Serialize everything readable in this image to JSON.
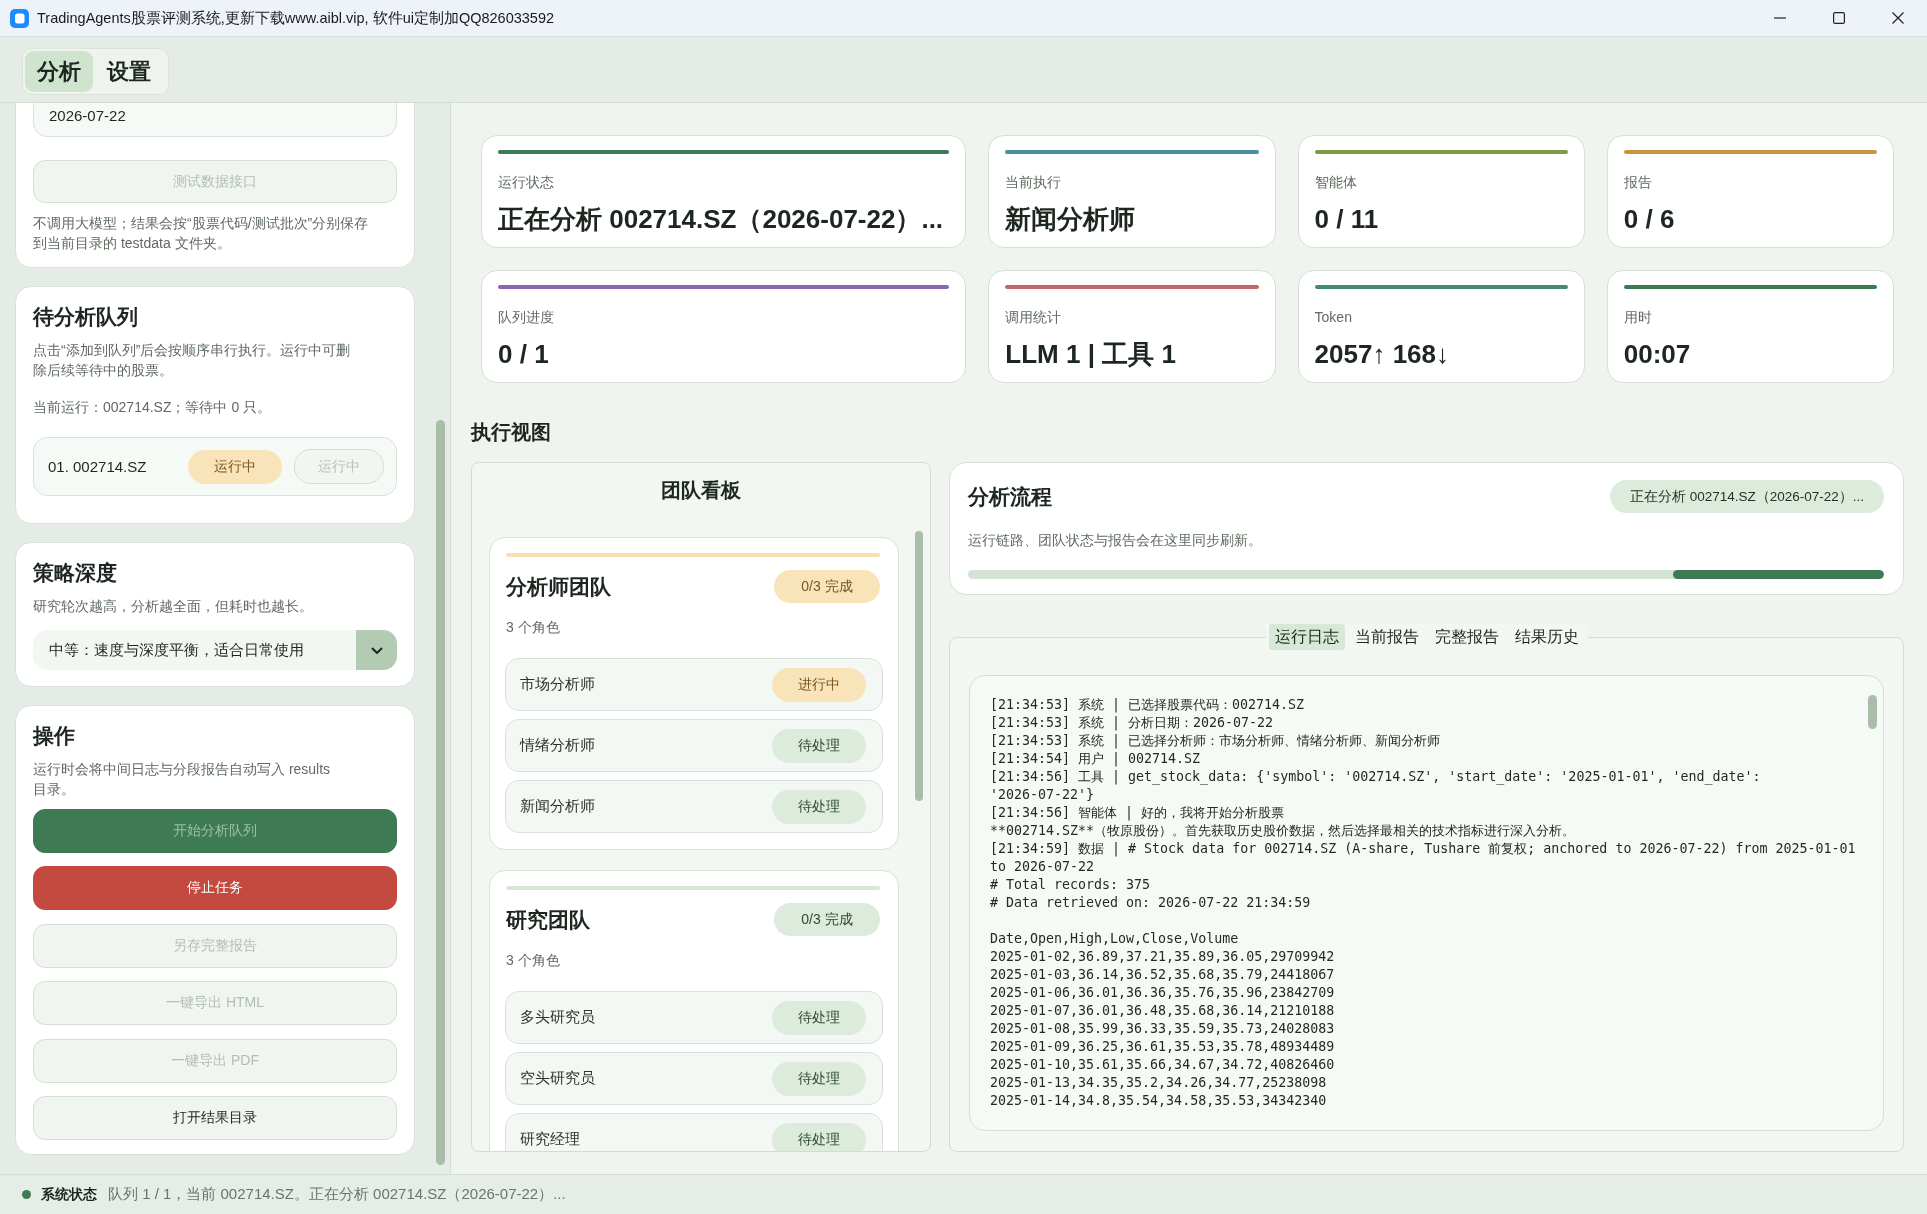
{
  "window": {
    "title": "TradingAgents股票评测系统,更新下载www.aibl.vip, 软件ui定制加QQ826033592"
  },
  "tabs": [
    {
      "label": "分析",
      "selected": true
    },
    {
      "label": "设置",
      "selected": false
    }
  ],
  "sidebar": {
    "data_source": {
      "date": "2026-07-22",
      "test_button": {
        "label": "测试数据接口",
        "disabled": true
      },
      "note": "不调用大模型；结果会按“股票代码/测试批次”分别保存到当前目录的 testdata 文件夹。"
    },
    "queue": {
      "title": "待分析队列",
      "description": "点击“添加到队列”后会按顺序串行执行。运行中可删除后续等待中的股票。",
      "summary": "当前运行：002714.SZ；等待中 0 只。",
      "items": [
        {
          "label": "01. 002714.SZ",
          "status": "运行中",
          "kind": "running",
          "action": {
            "label": "运行中",
            "disabled": true
          }
        }
      ]
    },
    "depth": {
      "title": "策略深度",
      "description": "研究轮次越高，分析越全面，但耗时也越长。",
      "selected_option": "中等：速度与深度平衡，适合日常使用"
    },
    "actions": {
      "title": "操作",
      "description": "运行时会将中间日志与分段报告自动写入 results 目录。",
      "buttons": [
        {
          "label": "开始分析队列",
          "kind": "primary",
          "disabled": true
        },
        {
          "label": "停止任务",
          "kind": "danger",
          "disabled": false
        },
        {
          "label": "另存完整报告",
          "kind": "normal",
          "disabled": true
        },
        {
          "label": "一键导出 HTML",
          "kind": "normal",
          "disabled": true
        },
        {
          "label": "一键导出 PDF",
          "kind": "normal",
          "disabled": true
        },
        {
          "label": "打开结果目录",
          "kind": "normal",
          "disabled": false
        }
      ]
    }
  },
  "stats": [
    {
      "label": "运行状态",
      "value": "正在分析 002714.SZ（2026-07-22）...",
      "color": "#3d7a55"
    },
    {
      "label": "当前执行",
      "value": "新闻分析师",
      "color": "#4b8ca0"
    },
    {
      "label": "智能体",
      "value": "0 / 11",
      "color": "#7e9a45"
    },
    {
      "label": "报告",
      "value": "0 / 6",
      "color": "#c8963e"
    },
    {
      "label": "队列进度",
      "value": "0 / 1",
      "color": "#8c64b4"
    },
    {
      "label": "调用统计",
      "value": "LLM 1 | 工具 1",
      "color": "#c0686c"
    },
    {
      "label": "Token",
      "value": "2057↑ 168↓",
      "color": "#448a78"
    },
    {
      "label": "用时",
      "value": "00:07",
      "color": "#3c7a52"
    }
  ],
  "execution": {
    "title": "执行视图",
    "team_board": {
      "title": "团队看板",
      "teams": [
        {
          "name": "分析师团队",
          "progress": "0/3 完成",
          "active": true,
          "role_count": "3 个角色",
          "members": [
            {
              "name": "市场分析师",
              "status": "进行中",
              "kind": "running"
            },
            {
              "name": "情绪分析师",
              "status": "待处理",
              "kind": "pending"
            },
            {
              "name": "新闻分析师",
              "status": "待处理",
              "kind": "pending"
            }
          ]
        },
        {
          "name": "研究团队",
          "progress": "0/3 完成",
          "active": false,
          "role_count": "3 个角色",
          "members": [
            {
              "name": "多头研究员",
              "status": "待处理",
              "kind": "pending"
            },
            {
              "name": "空头研究员",
              "status": "待处理",
              "kind": "pending"
            },
            {
              "name": "研究经理",
              "status": "待处理",
              "kind": "pending"
            }
          ]
        }
      ]
    },
    "flow": {
      "title": "分析流程",
      "status": "正在分析 002714.SZ（2026-07-22）...",
      "description": "运行链路、团队状态与报告会在这里同步刷新。",
      "level": 0.23
    },
    "tabs": [
      {
        "label": "运行日志",
        "selected": true
      },
      {
        "label": "当前报告",
        "selected": false
      },
      {
        "label": "完整报告",
        "selected": false
      },
      {
        "label": "结果历史",
        "selected": false
      }
    ],
    "log": [
      [
        "[21:34:53] 系统 | 已选择股票代码：002714.SZ",
        "[21:34:53] 系统 | 分析日期：2026-07-22",
        "[21:34:53] 系统 | 已选择分析师：市场分析师、情绪分析师、新闻分析师",
        "[21:34:54] 用户 | 002714.SZ",
        "[21:34:56] 工具 | get_stock_data: {'symbol': '002714.SZ', 'start_date': '2025-01-01', 'end_date':",
        "'2026-07-22'}",
        "[21:34:56] 智能体 | 好的，我将开始分析股票",
        "**002714.SZ**（牧原股份）。首先获取历史股价数据，然后选择最相关的技术指标进行深入分析。",
        "[21:34:59] 数据 | # Stock data for 002714.SZ (A-share, Tushare 前复权; anchored to 2026-07-22) from 2025-01-01",
        "to 2026-07-22",
        "# Total records: 375",
        "# Data retrieved on: 2026-07-22 21:34:59"
      ],
      [
        "Date,Open,High,Low,Close,Volume",
        "2025-01-02,36.89,37.21,35.89,36.05,29709942",
        "2025-01-03,36.14,36.52,35.68,35.79,24418067",
        "2025-01-06,36.01,36.36,35.76,35.96,23842709",
        "2025-01-07,36.01,36.48,35.68,36.14,21210188",
        "2025-01-08,35.99,36.33,35.59,35.73,24028083",
        "2025-01-09,36.25,36.61,35.53,35.78,48934489",
        "2025-01-10,35.61,35.66,34.67,34.72,40826460",
        "2025-01-13,34.35,35.2,34.26,34.77,25238098",
        "2025-01-14,34.8,35.54,34.58,35.53,34342340"
      ]
    ]
  },
  "status_bar": {
    "label": "系统状态",
    "message": "队列 1 / 1，当前 002714.SZ。正在分析 002714.SZ（2026-07-22）..."
  }
}
